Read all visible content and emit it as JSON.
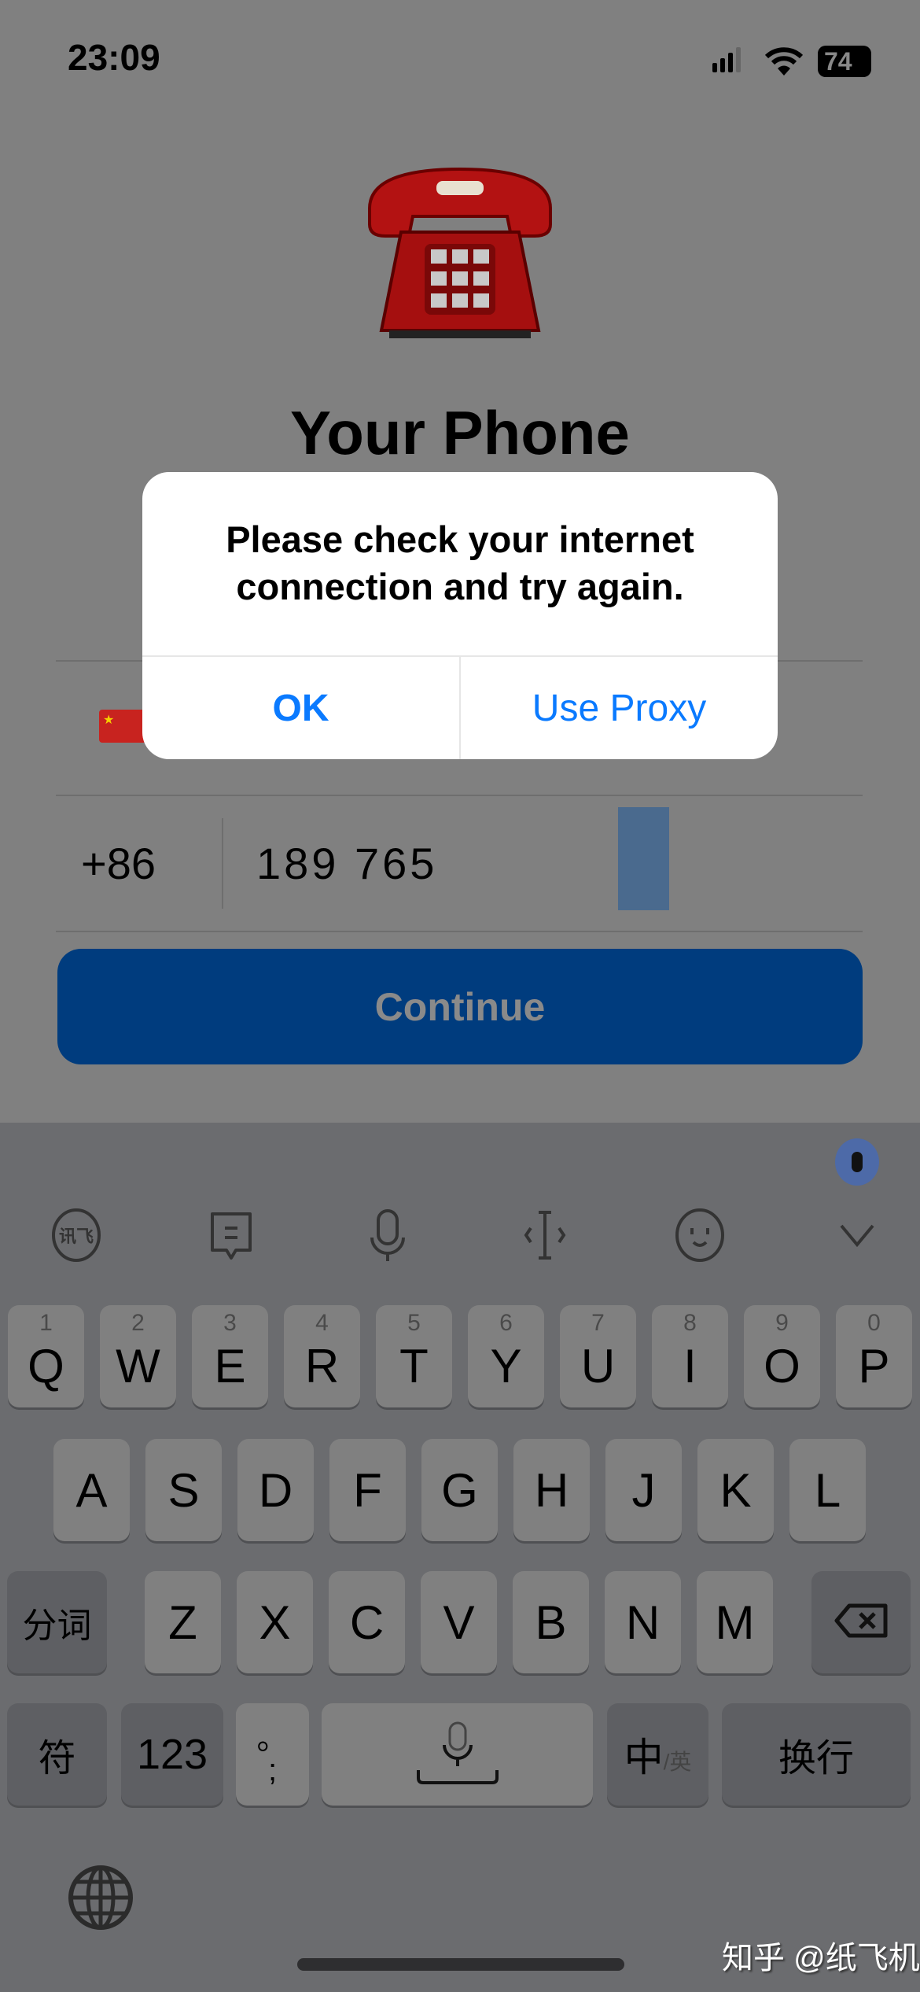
{
  "status": {
    "time": "23:09",
    "battery": "74"
  },
  "header": {
    "title": "Your Phone"
  },
  "dialog": {
    "message": "Please check your internet connection and try again.",
    "ok_label": "OK",
    "proxy_label": "Use Proxy"
  },
  "form": {
    "country_code": "+86",
    "phone_number": "189 765"
  },
  "continue_label": "Continue",
  "keyboard": {
    "row1": [
      {
        "k": "Q",
        "n": "1"
      },
      {
        "k": "W",
        "n": "2"
      },
      {
        "k": "E",
        "n": "3"
      },
      {
        "k": "R",
        "n": "4"
      },
      {
        "k": "T",
        "n": "5"
      },
      {
        "k": "Y",
        "n": "6"
      },
      {
        "k": "U",
        "n": "7"
      },
      {
        "k": "I",
        "n": "8"
      },
      {
        "k": "O",
        "n": "9"
      },
      {
        "k": "P",
        "n": "0"
      }
    ],
    "row2": [
      "A",
      "S",
      "D",
      "F",
      "G",
      "H",
      "J",
      "K",
      "L"
    ],
    "row3": [
      "Z",
      "X",
      "C",
      "V",
      "B",
      "N",
      "M"
    ],
    "segment": "分词",
    "symbols": "符",
    "numbers": "123",
    "punct": "。\n;",
    "lang_main": "中",
    "lang_sub": "/英",
    "return": "换行"
  },
  "watermark": "知乎 @纸飞机",
  "colors": {
    "accent": "#0a7aff",
    "button": "#003c7e"
  }
}
